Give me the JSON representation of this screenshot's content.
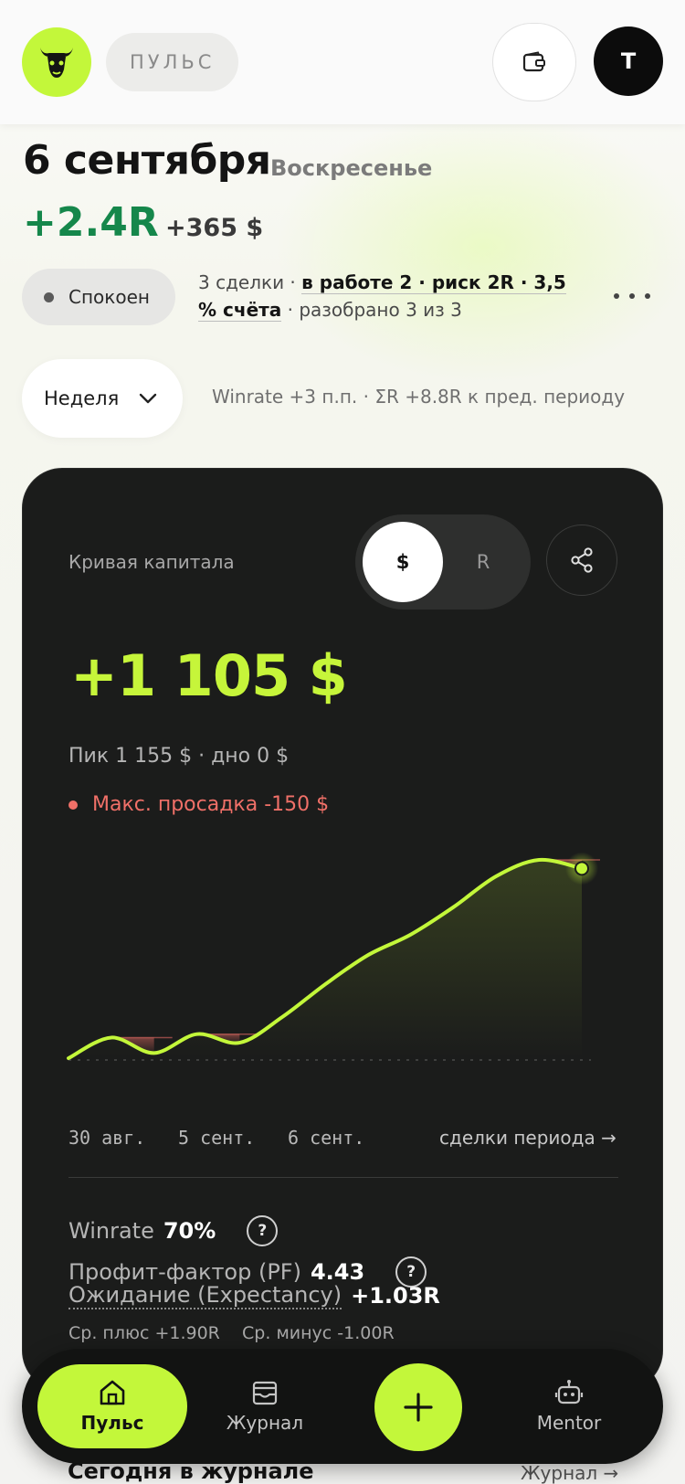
{
  "header": {
    "brand_label": "ПУЛЬС",
    "avatar_initial": "T",
    "icons": {
      "logo": "bull-logo-icon",
      "wallet": "wallet-icon"
    }
  },
  "day": {
    "date": "6 сентября",
    "weekday": "Воскресенье",
    "result_r": "+2.4R",
    "result_usd": "+365 $",
    "status": "Спокоен",
    "summary_prefix": "3 сделки · ",
    "summary_highlight": "в работе 2 · риск 2R · 3,5 % счёта",
    "summary_suffix": " · разобрано 3 из 3"
  },
  "period": {
    "selected": "Неделя",
    "comparison": "Winrate +3 п.п. · ΣR +8.8R к пред. периоду"
  },
  "equity_card": {
    "title": "Кривая капитала",
    "toggle_active": "$",
    "toggle_inactive": "R",
    "total": "+1 105 $",
    "peak_text": "Пик 1 155 $ · дно 0 $",
    "max_drawdown_text": "Макс. просадка -150 $",
    "x_labels": [
      "30 авг.",
      "5 сент.",
      "6 сент."
    ],
    "trades_link": "сделки периода →",
    "metrics": {
      "winrate_label": "Winrate",
      "winrate_value": "70%",
      "pf_label": "Профит-фактор (PF)",
      "pf_value": "4.43",
      "expectancy_label": "Ожидание (Expectancy)",
      "expectancy_value": "+1.03R",
      "help_symbol": "?",
      "avg_text": "Ср. плюс +1.90R    Ср. минус -1.00R"
    }
  },
  "chart_data": {
    "type": "area",
    "title": "Кривая капитала",
    "x": [
      0,
      1,
      2,
      3,
      4,
      5,
      6,
      7,
      8,
      9,
      10,
      11,
      12,
      13,
      14,
      15
    ],
    "series": [
      {
        "values": [
          0,
          120,
          30,
          140,
          90,
          240,
          430,
          600,
          720,
          880,
          1060,
          1155,
          1105
        ]
      }
    ],
    "x_tick_labels": [
      "30 авг.",
      "5 сент.",
      "6 сент."
    ],
    "ylim": [
      0,
      1155
    ],
    "peak": 1155,
    "trough": 0,
    "final": 1105,
    "max_drawdown": -150,
    "grid": false,
    "line_color": "#c3f73a",
    "drawdown_color": "#f07068"
  },
  "today_section": {
    "title": "Сегодня в журнале",
    "link": "Журнал →"
  },
  "bottom_nav": {
    "items": [
      {
        "label": "Пульс",
        "icon": "home-icon"
      },
      {
        "label": "Журнал",
        "icon": "inbox-icon"
      },
      {
        "label": "Mentor",
        "icon": "robot-icon"
      }
    ],
    "fab_icon": "plus-icon"
  },
  "colors": {
    "accent": "#c3f73a",
    "positive": "#15874b",
    "negative": "#f07068",
    "card_bg": "#1b1c1b"
  }
}
